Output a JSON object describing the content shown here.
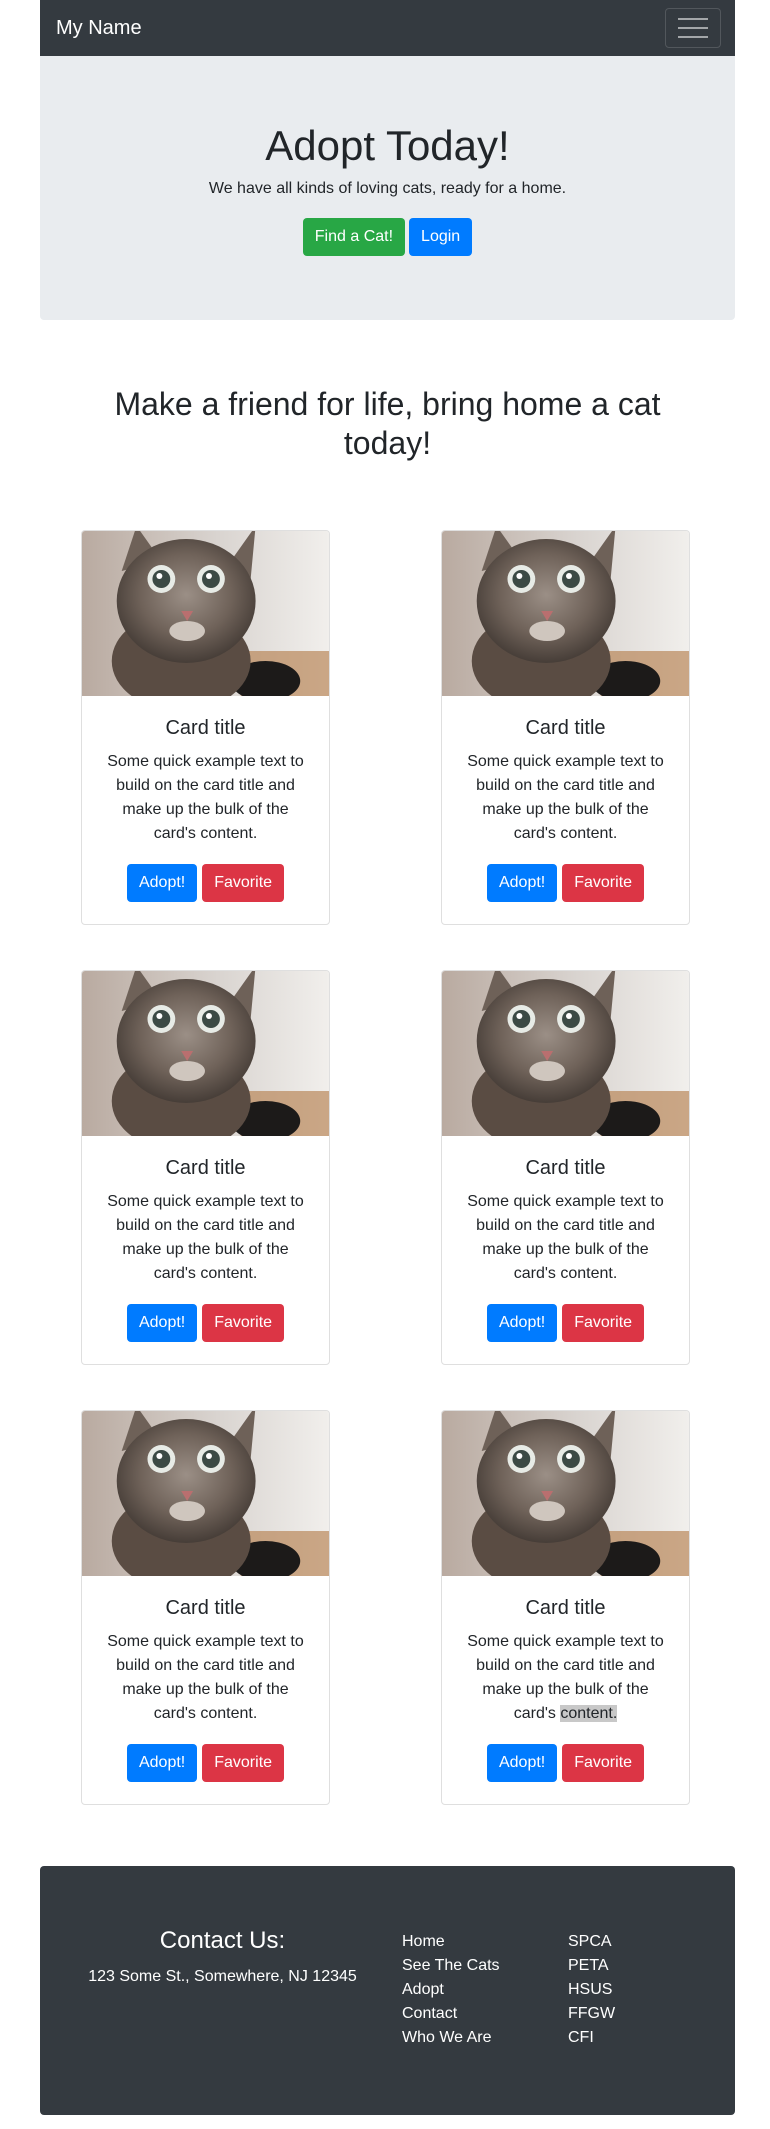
{
  "navbar": {
    "brand": "My Name",
    "toggler_icon": "hamburger-icon"
  },
  "jumbotron": {
    "title": "Adopt Today!",
    "subtitle": "We have all kinds of loving cats, ready for a home.",
    "find_button": "Find a Cat!",
    "login_button": "Login"
  },
  "lead_heading": "Make a friend for life, bring home a cat today!",
  "cards": [
    {
      "image": "kitten-photo",
      "title": "Card title",
      "text": "Some quick example text to build on the card title and make up the bulk of the card's content.",
      "adopt": "Adopt!",
      "favorite": "Favorite"
    },
    {
      "image": "kitten-photo",
      "title": "Card title",
      "text": "Some quick example text to build on the card title and make up the bulk of the card's content.",
      "adopt": "Adopt!",
      "favorite": "Favorite"
    },
    {
      "image": "kitten-photo",
      "title": "Card title",
      "text": "Some quick example text to build on the card title and make up the bulk of the card's content.",
      "adopt": "Adopt!",
      "favorite": "Favorite"
    },
    {
      "image": "kitten-photo",
      "title": "Card title",
      "text": "Some quick example text to build on the card title and make up the bulk of the card's content.",
      "adopt": "Adopt!",
      "favorite": "Favorite"
    },
    {
      "image": "kitten-photo",
      "title": "Card title",
      "text": "Some quick example text to build on the card title and make up the bulk of the card's content.",
      "adopt": "Adopt!",
      "favorite": "Favorite"
    },
    {
      "image": "kitten-photo",
      "title": "Card title",
      "text_before": "Some quick example text to build on the card title and make up the bulk of the card's ",
      "text_highlighted": "content.",
      "adopt": "Adopt!",
      "favorite": "Favorite"
    }
  ],
  "footer": {
    "contact_title": "Contact Us:",
    "address": "123 Some St., Somewhere, NJ 12345",
    "links_a": [
      "Home",
      "See The Cats",
      "Adopt",
      "Contact",
      "Who We Are"
    ],
    "links_b": [
      "SPCA",
      "PETA",
      "HSUS",
      "FFGW",
      "CFI"
    ]
  },
  "colors": {
    "navbar": "#343a40",
    "jumbotron": "#e9ecef",
    "success": "#28a745",
    "primary": "#007bff",
    "danger": "#dc3545"
  }
}
